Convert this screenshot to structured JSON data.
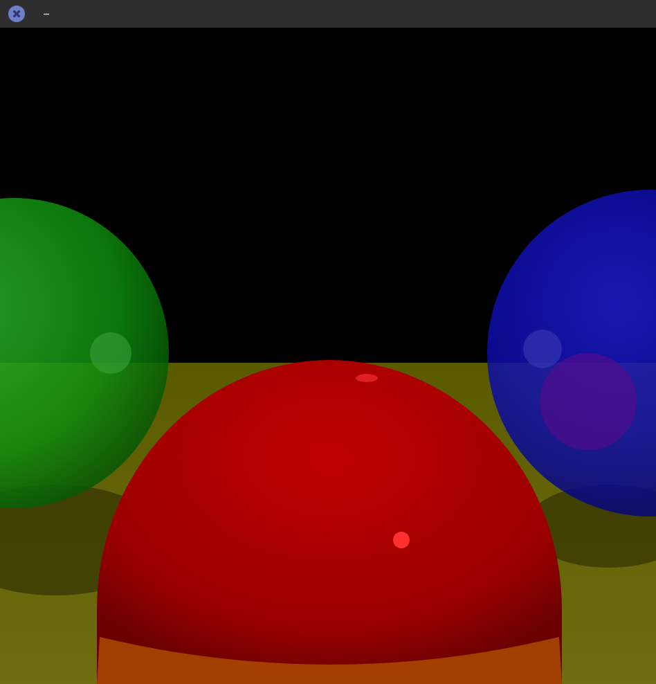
{
  "window": {
    "title": "–"
  }
}
